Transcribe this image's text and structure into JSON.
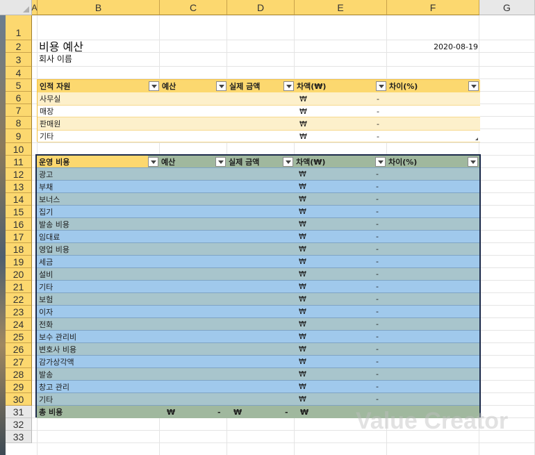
{
  "columns": [
    "A",
    "B",
    "C",
    "D",
    "E",
    "F",
    "G"
  ],
  "rows": [
    "1",
    "2",
    "3",
    "4",
    "5",
    "6",
    "7",
    "8",
    "9",
    "10",
    "11",
    "12",
    "13",
    "14",
    "15",
    "16",
    "17",
    "18",
    "19",
    "20",
    "21",
    "22",
    "23",
    "24",
    "25",
    "26",
    "27",
    "28",
    "29",
    "30",
    "31",
    "32",
    "33"
  ],
  "header": {
    "title": "비용 예산",
    "company": "회사 이름",
    "date": "2020-08-19"
  },
  "table1": {
    "headers": [
      "인적 자원",
      "예산",
      "실제 금액",
      "차액(₩)",
      "차이(%)"
    ],
    "rows": [
      {
        "label": "사무실",
        "won": "₩",
        "dash": "-"
      },
      {
        "label": "매장",
        "won": "₩",
        "dash": "-"
      },
      {
        "label": "판매원",
        "won": "₩",
        "dash": "-"
      },
      {
        "label": "기타",
        "won": "₩",
        "dash": "-"
      }
    ]
  },
  "table2": {
    "headers": [
      "운영 비용",
      "예산",
      "실제 금액",
      "차액(₩)",
      "차이(%)"
    ],
    "rows": [
      {
        "label": "광고",
        "won": "₩",
        "dash": "-"
      },
      {
        "label": "부채",
        "won": "₩",
        "dash": "-"
      },
      {
        "label": "보너스",
        "won": "₩",
        "dash": "-"
      },
      {
        "label": "집기",
        "won": "₩",
        "dash": "-"
      },
      {
        "label": "발송 비용",
        "won": "₩",
        "dash": "-"
      },
      {
        "label": "임대료",
        "won": "₩",
        "dash": "-"
      },
      {
        "label": "영업 비용",
        "won": "₩",
        "dash": "-"
      },
      {
        "label": "세금",
        "won": "₩",
        "dash": "-"
      },
      {
        "label": "설비",
        "won": "₩",
        "dash": "-"
      },
      {
        "label": "기타",
        "won": "₩",
        "dash": "-"
      },
      {
        "label": "보험",
        "won": "₩",
        "dash": "-"
      },
      {
        "label": "이자",
        "won": "₩",
        "dash": "-"
      },
      {
        "label": "전화",
        "won": "₩",
        "dash": "-"
      },
      {
        "label": "보수 관리비",
        "won": "₩",
        "dash": "-"
      },
      {
        "label": "변호사 비용",
        "won": "₩",
        "dash": "-"
      },
      {
        "label": "감가상각액",
        "won": "₩",
        "dash": "-"
      },
      {
        "label": "발송",
        "won": "₩",
        "dash": "-"
      },
      {
        "label": "창고 관리",
        "won": "₩",
        "dash": "-"
      },
      {
        "label": "기타",
        "won": "₩",
        "dash": "-"
      }
    ],
    "total": {
      "label": "총 비용",
      "budget_won": "₩",
      "budget_dash": "-",
      "actual_won": "₩",
      "actual_dash": "-",
      "diff_won": "₩"
    }
  },
  "watermark": "Value Creator",
  "colors": {
    "selection_header": "#fcd86f",
    "table1_header": "#fcd86f",
    "table1_band": "#fdf0cb",
    "table2_header": "#a0b89e",
    "table2_odd": "#a8c5cc",
    "table2_even": "#a0c9ec",
    "table2_border": "#1b2a4a"
  }
}
